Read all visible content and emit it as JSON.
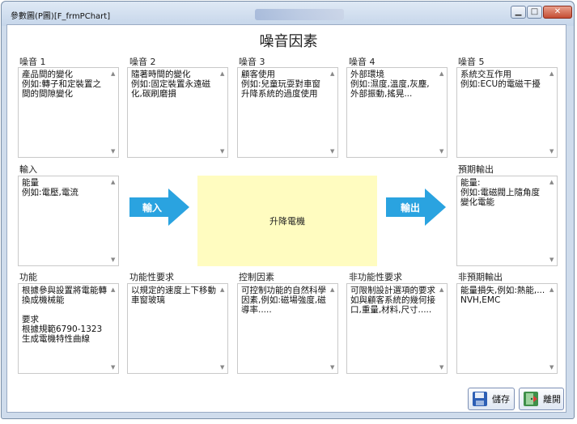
{
  "window": {
    "title": "參數圖(P圖)[F_frmPChart]"
  },
  "main_title": "噪音因素",
  "noise": [
    {
      "label": "噪音 1",
      "lines": [
        "產品間的變化",
        "例如:轉子和定裝置之間的間隙變化"
      ]
    },
    {
      "label": "噪音 2",
      "lines": [
        "隨著時間的變化",
        "例如:固定裝置永遠磁化,碳刷磨損"
      ]
    },
    {
      "label": "噪音 3",
      "lines": [
        "顧客使用",
        "例如:兒童玩耍對車窗升降系統的過度使用"
      ]
    },
    {
      "label": "噪音 4",
      "lines": [
        "外部環境",
        "例如:濕度,溫度,灰塵,外部振動,搖晃..."
      ]
    },
    {
      "label": "噪音 5",
      "lines": [
        "系統交互作用",
        "例如:ECU的電磁干擾"
      ]
    }
  ],
  "input": {
    "label": "輸入",
    "lines": [
      "能量",
      "例如:電壓,電流"
    ]
  },
  "expected_output": {
    "label": "預期輸出",
    "lines": [
      "能量:",
      "例如:電磁閥上隨角度變化電能"
    ]
  },
  "input_arrow_label": "輸入",
  "output_arrow_label": "輸出",
  "system_name": "升降電機",
  "bottom": [
    {
      "label": "功能",
      "lines": [
        "根據參與設置將電能轉換成機械能",
        "",
        "要求",
        "根據規範6790-1323生成電機特性曲線"
      ]
    },
    {
      "label": "功能性要求",
      "lines": [
        "以規定的速度上下移動車窗玻璃"
      ]
    },
    {
      "label": "控制因素",
      "lines": [
        "可控制功能的自然科學因素,例如:磁場強度,磁導率....."
      ]
    },
    {
      "label": "非功能性要求",
      "lines": [
        "可限制設計選項的要求如與顧客系統的幾何接口,重量,材料,尺寸....."
      ]
    },
    {
      "label": "非預期輸出",
      "lines": [
        "能量損失,例如:熱能,...NVH,EMC"
      ]
    }
  ],
  "buttons": {
    "save": "儲存",
    "exit": "離開"
  },
  "colors": {
    "arrow": "#2aa3e0",
    "center_fill": "#fffcc0",
    "window_frame": "#cfdcec"
  },
  "icons": {
    "save": "floppy-disk-icon",
    "exit": "exit-door-icon"
  }
}
